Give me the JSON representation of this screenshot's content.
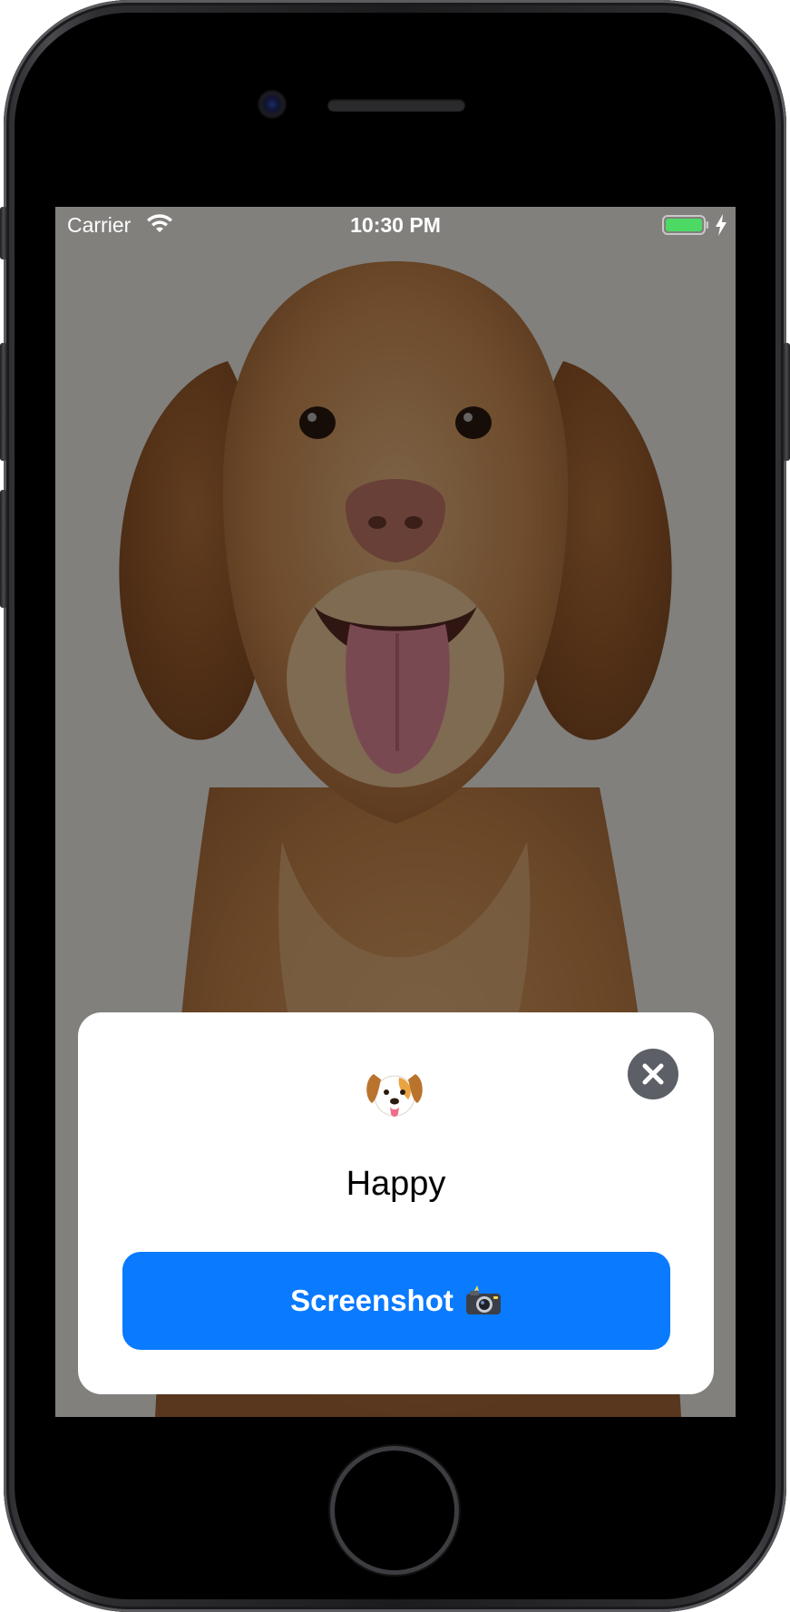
{
  "status_bar": {
    "carrier": "Carrier",
    "time": "10:30 PM",
    "wifi_icon": "wifi-icon",
    "battery_icon": "battery-icon",
    "charging_icon": "charging-icon"
  },
  "card": {
    "emoji_icon": "dog-face-icon",
    "mood": "Happy",
    "screenshot_label": "Screenshot",
    "screenshot_icon": "camera-with-flash-icon",
    "close_icon": "close-icon"
  },
  "colors": {
    "accent": "#0a7aff",
    "close_button": "#5c5f66",
    "battery": "#4cd964",
    "card": "#ffffff"
  }
}
